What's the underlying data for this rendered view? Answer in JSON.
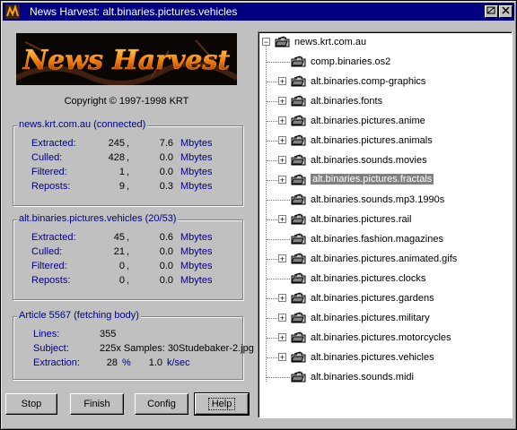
{
  "window": {
    "title": "News Harvest: alt.binaries.pictures.vehicles"
  },
  "logo": {
    "text": "News Harvest"
  },
  "copyright": "Copyright © 1997-1998 KRT",
  "server": {
    "title": "news.krt.com.au (connected)",
    "rows": [
      {
        "label": "Extracted:",
        "count": "245",
        "size": "7.6",
        "unit": "Mbytes"
      },
      {
        "label": "Culled:",
        "count": "428",
        "size": "0.0",
        "unit": "Mbytes"
      },
      {
        "label": "Filtered:",
        "count": "1",
        "size": "0.0",
        "unit": "Mbytes"
      },
      {
        "label": "Reposts:",
        "count": "9",
        "size": "0.3",
        "unit": "Mbytes"
      }
    ]
  },
  "group": {
    "title": "alt.binaries.pictures.vehicles (20/53)",
    "rows": [
      {
        "label": "Extracted:",
        "count": "45",
        "size": "0.6",
        "unit": "Mbytes"
      },
      {
        "label": "Culled:",
        "count": "21",
        "size": "0.0",
        "unit": "Mbytes"
      },
      {
        "label": "Filtered:",
        "count": "0",
        "size": "0.0",
        "unit": "Mbytes"
      },
      {
        "label": "Reposts:",
        "count": "0",
        "size": "0.0",
        "unit": "Mbytes"
      }
    ]
  },
  "article": {
    "title": "Article 5567 (fetching body)",
    "lines_label": "Lines:",
    "lines": "355",
    "subject_label": "Subject:",
    "subject": "225x Samples: 30Studebaker-2.jpg",
    "extraction_label": "Extraction:",
    "extraction_pct": "28",
    "pct_sign": "%",
    "rate": "1.0",
    "rate_unit": "k/sec"
  },
  "buttons": {
    "stop": "Stop",
    "finish": "Finish",
    "config": "Config",
    "help": "Help"
  },
  "tree": {
    "root": "news.krt.com.au",
    "root_expander": "−",
    "items": [
      {
        "label": "comp.binaries.os2",
        "expander": ""
      },
      {
        "label": "alt.binaries.comp-graphics",
        "expander": "+"
      },
      {
        "label": "alt.binaries.fonts",
        "expander": "+"
      },
      {
        "label": "alt.binaries.pictures.anime",
        "expander": "+"
      },
      {
        "label": "alt.binaries.pictures.animals",
        "expander": "+"
      },
      {
        "label": "alt.binaries.sounds.movies",
        "expander": "+"
      },
      {
        "label": "alt.binaries.pictures.fractals",
        "expander": "+",
        "selected": true
      },
      {
        "label": "alt.binaries.sounds.mp3.1990s",
        "expander": ""
      },
      {
        "label": "alt.binaries.pictures.rail",
        "expander": "+"
      },
      {
        "label": "alt.binaries.fashion.magazines",
        "expander": ""
      },
      {
        "label": "alt.binaries.pictures.animated.gifs",
        "expander": "+"
      },
      {
        "label": "alt.binaries.pictures.clocks",
        "expander": ""
      },
      {
        "label": "alt.binaries.pictures.gardens",
        "expander": "+"
      },
      {
        "label": "alt.binaries.pictures.military",
        "expander": "+"
      },
      {
        "label": "alt.binaries.pictures.motorcycles",
        "expander": "+"
      },
      {
        "label": "alt.binaries.pictures.vehicles",
        "expander": "+"
      },
      {
        "label": "alt.binaries.sounds.midi",
        "expander": ""
      }
    ]
  },
  "colors": {
    "titlebar": "#000080",
    "label": "#000080",
    "face": "#c0c0c0",
    "selection": "#808080"
  }
}
